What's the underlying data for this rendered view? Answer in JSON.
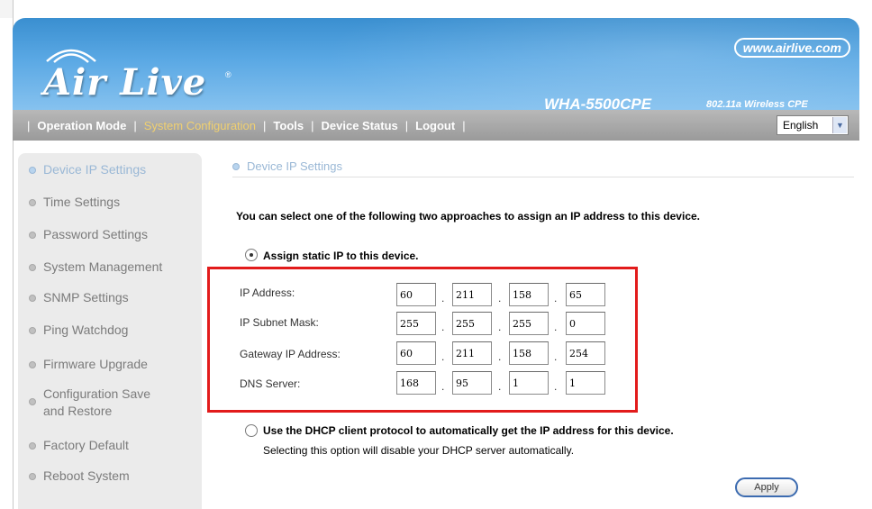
{
  "header": {
    "logo_text": "Air Live",
    "logo_reg": "®",
    "site_link": "www.airlive.com",
    "model_name": "WHA-5500CPE",
    "model_desc": "802.11a Wireless CPE"
  },
  "nav": {
    "items": [
      "Operation Mode",
      "System Configuration",
      "Tools",
      "Device Status",
      "Logout"
    ],
    "active": "System Configuration",
    "separator": "|",
    "language": "English"
  },
  "sidebar": {
    "items": [
      {
        "label": "Device IP Settings",
        "active": true
      },
      {
        "label": "Time Settings"
      },
      {
        "label": "Password Settings"
      },
      {
        "label": "System Management"
      },
      {
        "label": "SNMP Settings"
      },
      {
        "label": "Ping Watchdog"
      },
      {
        "label": "Firmware Upgrade"
      },
      {
        "label": "Configuration Save and Restore"
      },
      {
        "label": "Factory Default"
      },
      {
        "label": "Reboot System"
      }
    ]
  },
  "content": {
    "title": "Device IP Settings",
    "intro": "You can select one of the following two approaches to assign an IP address to this device.",
    "static_option": "Assign static IP to this device.",
    "fields": {
      "ip_address": {
        "label": "IP Address:",
        "octets": [
          "60",
          "211",
          "158",
          "65"
        ]
      },
      "subnet_mask": {
        "label": "IP Subnet Mask:",
        "octets": [
          "255",
          "255",
          "255",
          "0"
        ]
      },
      "gateway": {
        "label": "Gateway IP Address:",
        "octets": [
          "60",
          "211",
          "158",
          "254"
        ]
      },
      "dns": {
        "label": "DNS Server:",
        "octets": [
          "168",
          "95",
          "1",
          "1"
        ]
      }
    },
    "octet_separator": ".",
    "dhcp_option": "Use the DHCP client protocol to automatically get the IP address for this device.",
    "dhcp_note": "Selecting this option will disable your DHCP server automatically.",
    "apply_label": "Apply"
  },
  "colors": {
    "header_blue": "#3a8fd0",
    "nav_gray": "#a8a8a8",
    "nav_active": "#f0d070",
    "sidebar_bg": "#ebebeb",
    "highlight": "#e21b1b"
  }
}
